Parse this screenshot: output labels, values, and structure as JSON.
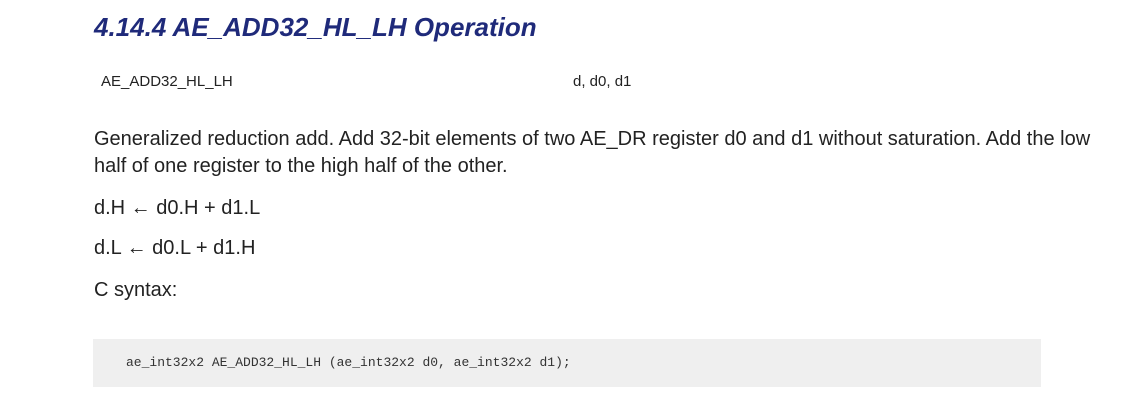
{
  "section": {
    "heading": "4.14.4 AE_ADD32_HL_LH Operation"
  },
  "signature": {
    "name": "AE_ADD32_HL_LH",
    "args": "d, d0, d1"
  },
  "description": "Generalized reduction add. Add 32-bit elements of two AE_DR register d0 and d1 without saturation. Add the low half of one register to the high half of the other.",
  "formulas": [
    "d.H ← d0.H + d1.L",
    "d.L ← d0.L + d1.H"
  ],
  "c_syntax_label": "C syntax:",
  "code": "ae_int32x2 AE_ADD32_HL_LH (ae_int32x2 d0, ae_int32x2 d1);",
  "colors": {
    "heading": "#1f2a7a",
    "code_background": "#efefef",
    "text": "#222222"
  }
}
